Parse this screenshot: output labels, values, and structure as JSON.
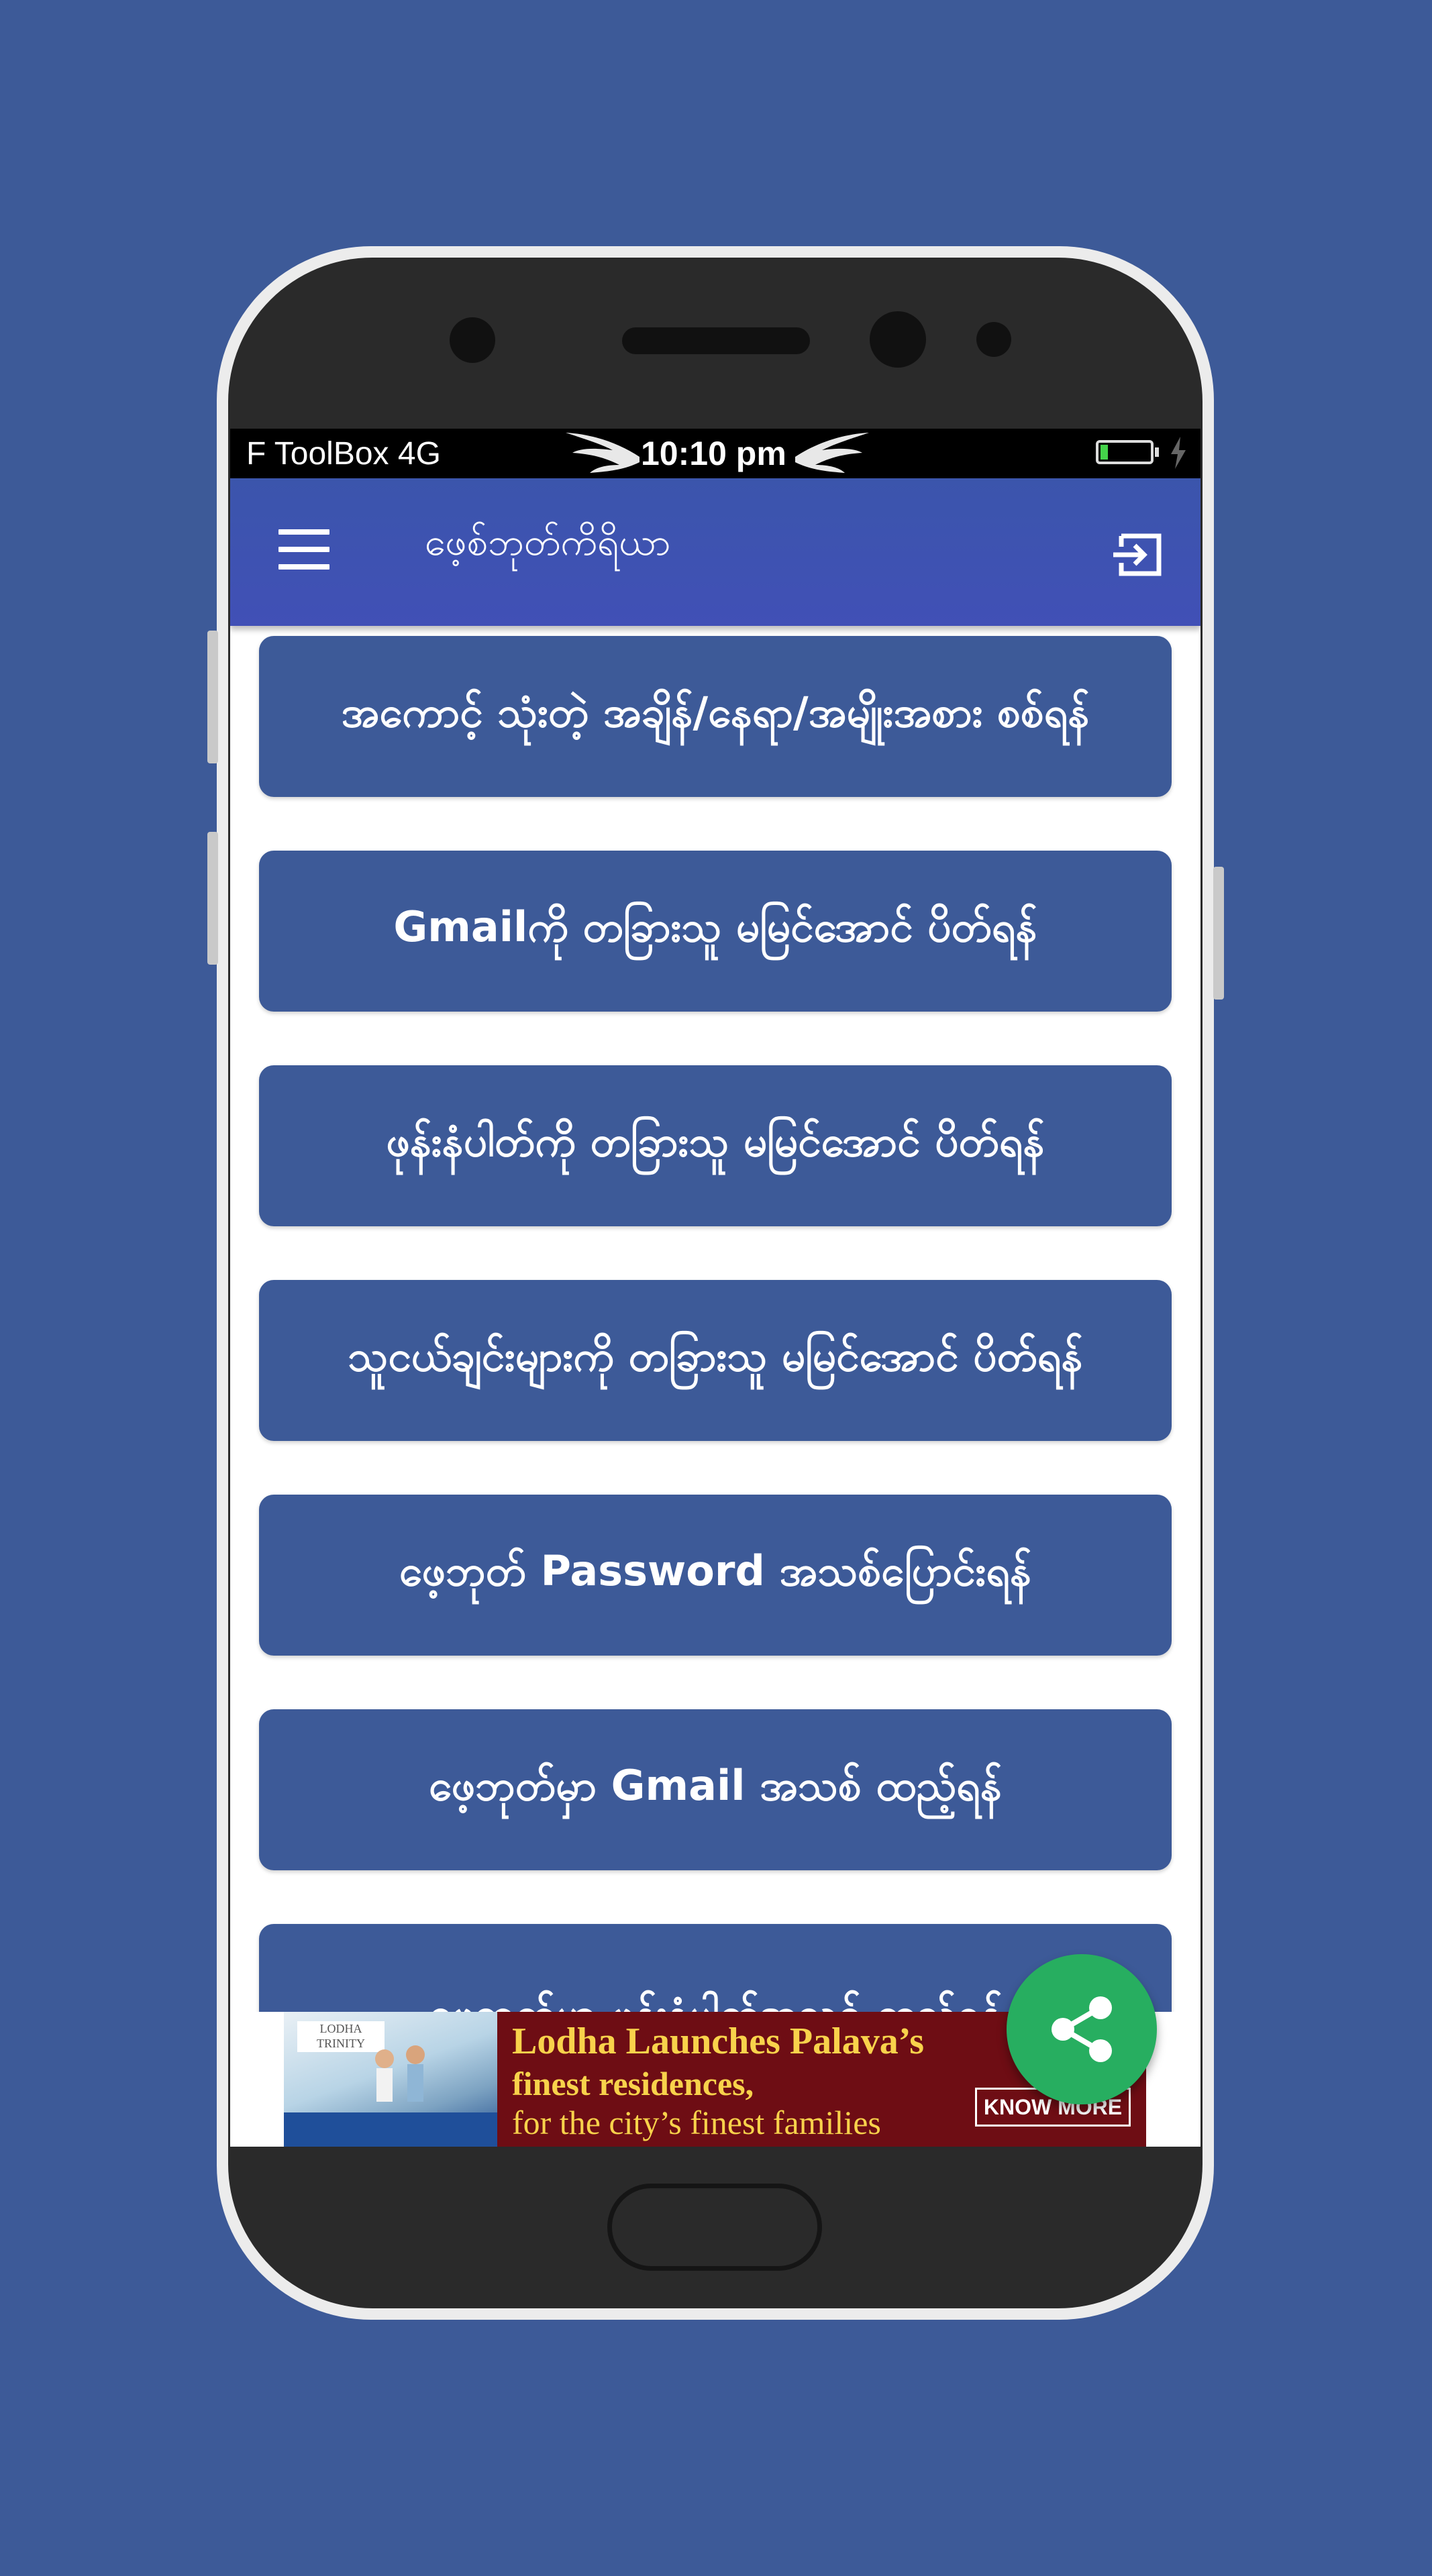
{
  "status_bar": {
    "carrier": "F ToolBox",
    "network": "4G",
    "time": "10:10 pm",
    "battery_level": 0.15
  },
  "app_bar": {
    "menu_icon": "hamburger-menu-icon",
    "title": "ဖေ့စ်ဘုတ်ကိရိယာ",
    "logout_icon": "logout-icon"
  },
  "menu_items": [
    {
      "label": "အကောင့် သုံးတဲ့ အချိန်/နေရာ/အမျိုးအစား စစ်ရန်"
    },
    {
      "label": "Gmailကို တခြားသူ မမြင်အောင် ပိတ်ရန်"
    },
    {
      "label": "ဖုန်းနံပါတ်ကို တခြားသူ မမြင်အောင် ပိတ်ရန်"
    },
    {
      "label": "သူငယ်ချင်းများကို တခြားသူ မမြင်အောင် ပိတ်ရန်"
    },
    {
      "label": "ဖေ့ဘုတ် Password အသစ်ပြောင်းရန်"
    },
    {
      "label": "ဖေ့ဘုတ်မှာ Gmail အသစ် ထည့်ရန်"
    },
    {
      "label": "ဖေ့ဘုတ်မှာ ဖုန်းနံပါတ်အသစ် ထည့်ရန်"
    }
  ],
  "ad": {
    "logo": "LODHA TRINITY",
    "line1": "Lodha Launches Palava’s",
    "line2": "finest residences,",
    "line3": "for the city’s finest families",
    "cta": "KNOW MORE"
  },
  "fab": {
    "icon": "share-icon"
  },
  "colors": {
    "page_background": "#3d5a98",
    "app_bar": "#4150b6",
    "item_background": "#3d5a98",
    "fab": "#27ae60",
    "ad_background": "#6e0d14"
  }
}
